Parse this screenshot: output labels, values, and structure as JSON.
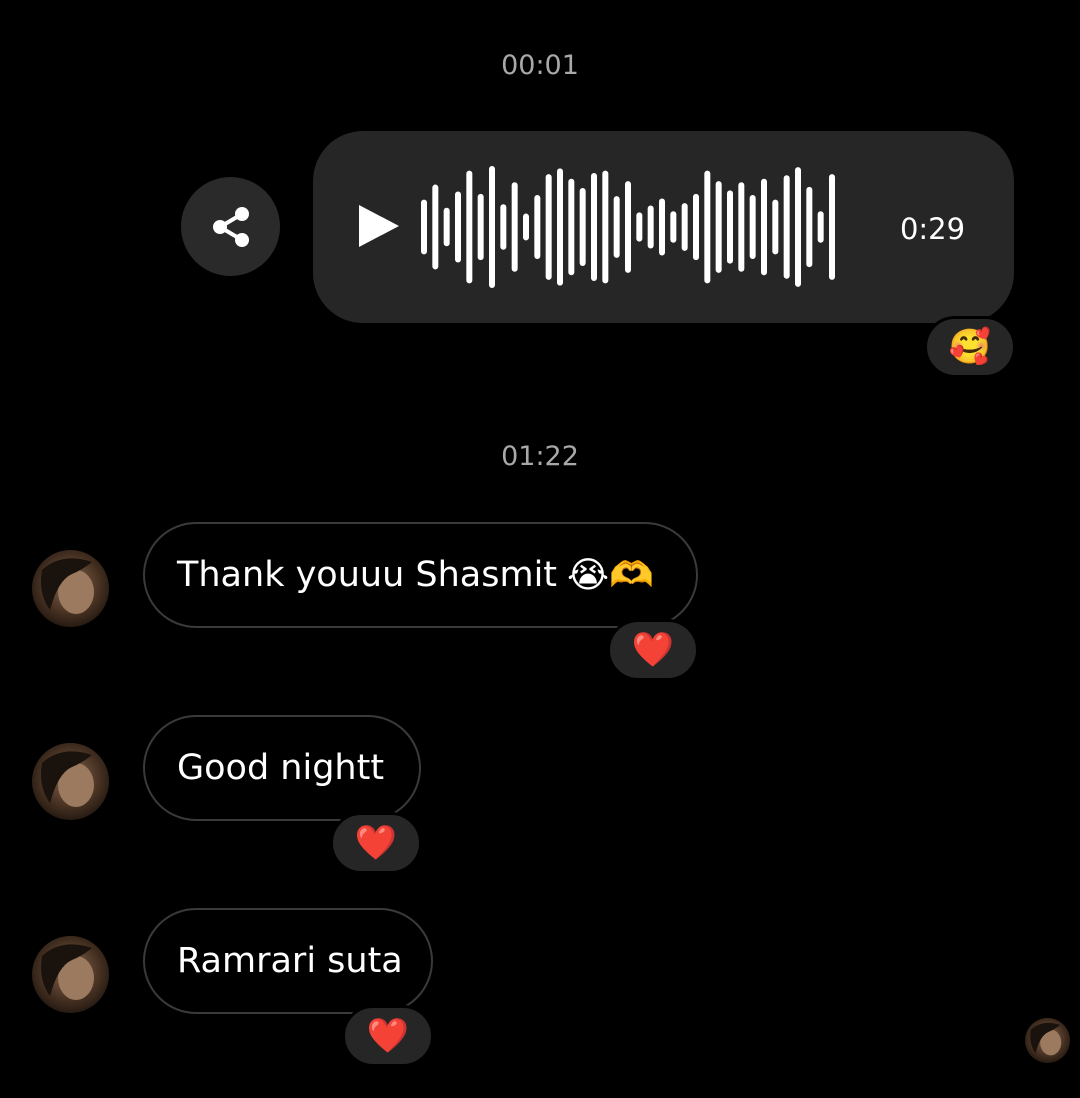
{
  "timestamps": [
    "00:01",
    "01:22"
  ],
  "voice_message": {
    "duration": "0:29",
    "play_icon": "play-icon",
    "share_icon": "share-icon",
    "reaction": "🥰",
    "waveform_levels": [
      0.42,
      0.68,
      0.28,
      0.56,
      0.92,
      0.52,
      1.0,
      0.34,
      0.72,
      0.18,
      0.5,
      0.86,
      0.96,
      0.78,
      0.62,
      0.88,
      0.92,
      0.48,
      0.74,
      0.2,
      0.32,
      0.44,
      0.22,
      0.36,
      0.52,
      0.92,
      0.74,
      0.58,
      0.72,
      0.5,
      0.78,
      0.42,
      0.84,
      0.98,
      0.64,
      0.22,
      0.86
    ]
  },
  "messages": [
    {
      "text": "Thank youuu Shasmit",
      "emoji": "😭🫶",
      "reaction": "❤️"
    },
    {
      "text": "Good nightt",
      "emoji": "",
      "reaction": "❤️"
    },
    {
      "text": "Ramrari suta",
      "emoji": "",
      "reaction": "❤️"
    }
  ],
  "colors": {
    "background": "#000000",
    "bubble": "#262626",
    "timestamp": "#a8a8a8",
    "outline": "#3a3a3a"
  }
}
